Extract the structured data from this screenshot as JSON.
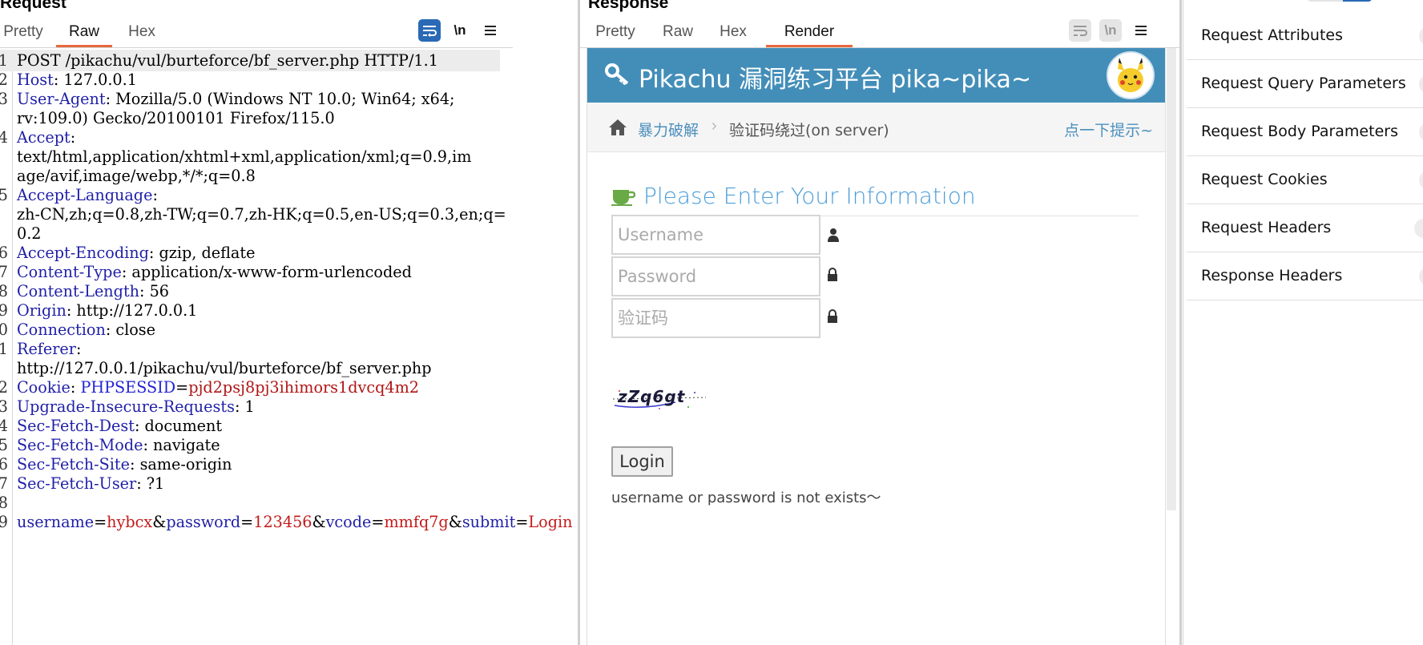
{
  "request": {
    "title": "Request",
    "tabs": [
      "Pretty",
      "Raw",
      "Hex"
    ],
    "active_tab": "Raw",
    "newline_label": "\\n",
    "lines": [
      {
        "n": "1",
        "key": "",
        "text": "POST /pikachu/vul/burteforce/bf_server.php HTTP/1.1"
      },
      {
        "n": "2",
        "key": "Host",
        "text": ": 127.0.0.1"
      },
      {
        "n": "3",
        "key": "User-Agent",
        "text": ": Mozilla/5.0 (Windows NT 10.0; Win64; x64;"
      },
      {
        "n": "",
        "key": "",
        "text": "rv:109.0) Gecko/20100101 Firefox/115.0"
      },
      {
        "n": "4",
        "key": "Accept",
        "text": ":"
      },
      {
        "n": "",
        "key": "",
        "text": "text/html,application/xhtml+xml,application/xml;q=0.9,im"
      },
      {
        "n": "",
        "key": "",
        "text": "age/avif,image/webp,*/*;q=0.8"
      },
      {
        "n": "5",
        "key": "Accept-Language",
        "text": ":"
      },
      {
        "n": "",
        "key": "",
        "text": "zh-CN,zh;q=0.8,zh-TW;q=0.7,zh-HK;q=0.5,en-US;q=0.3,en;q="
      },
      {
        "n": "",
        "key": "",
        "text": "0.2"
      },
      {
        "n": "6",
        "key": "Accept-Encoding",
        "text": ": gzip, deflate"
      },
      {
        "n": "7",
        "key": "Content-Type",
        "text": ": application/x-www-form-urlencoded"
      },
      {
        "n": "8",
        "key": "Content-Length",
        "text": ": 56"
      },
      {
        "n": "9",
        "key": "Origin",
        "text": ": http://127.0.0.1"
      },
      {
        "n": "0",
        "key": "Connection",
        "text": ": close"
      },
      {
        "n": "1",
        "key": "Referer",
        "text": ":"
      },
      {
        "n": "",
        "key": "",
        "text": "http://127.0.0.1/pikachu/vul/burteforce/bf_server.php"
      },
      {
        "n": "2",
        "key": "Cookie",
        "text": ": ",
        "cookie_name": "PHPSESSID",
        "cookie_value": "pjd2psj8pj3ihimors1dvcq4m2"
      },
      {
        "n": "3",
        "key": "Upgrade-Insecure-Requests",
        "text": ": 1"
      },
      {
        "n": "4",
        "key": "Sec-Fetch-Dest",
        "text": ": document"
      },
      {
        "n": "5",
        "key": "Sec-Fetch-Mode",
        "text": ": navigate"
      },
      {
        "n": "6",
        "key": "Sec-Fetch-Site",
        "text": ": same-origin"
      },
      {
        "n": "7",
        "key": "Sec-Fetch-User",
        "text": ": ?1"
      },
      {
        "n": "8",
        "key": "",
        "text": ""
      },
      {
        "n": "9",
        "key": "",
        "text": "",
        "params": [
          {
            "name": "username",
            "value": "hybcx"
          },
          {
            "name": "password",
            "value": "123456"
          },
          {
            "name": "vcode",
            "value": "mmfq7g"
          },
          {
            "name": "submit",
            "value": "Login"
          }
        ]
      }
    ]
  },
  "response": {
    "title": "Response",
    "tabs": [
      "Pretty",
      "Raw",
      "Hex",
      "Render"
    ],
    "active_tab": "Render",
    "newline_label": "\\n",
    "render": {
      "header_title": "Pikachu 漏洞练习平台 pika~pika~",
      "breadcrumb_1": "暴力破解",
      "breadcrumb_sep": "›",
      "breadcrumb_2": "验证码绕过(on server)",
      "hint_link": "点一下提示~",
      "form_title": "Please Enter Your Information",
      "username_placeholder": "Username",
      "password_placeholder": "Password",
      "vcode_placeholder": "验证码",
      "captcha_text": "zZq6gt",
      "login_label": "Login",
      "message": "username or password is not exists～"
    }
  },
  "inspector": {
    "items": [
      "Request Attributes",
      "Request Query Parameters",
      "Request Body Parameters",
      "Request Cookies",
      "Request Headers",
      "Response Headers"
    ]
  },
  "colors": {
    "accent_orange": "#e8683f",
    "pikachu_blue": "#438eb9",
    "header_key_blue": "#1f1fa8",
    "value_red": "#c41a1a",
    "burp_blue": "#2a69b6"
  }
}
